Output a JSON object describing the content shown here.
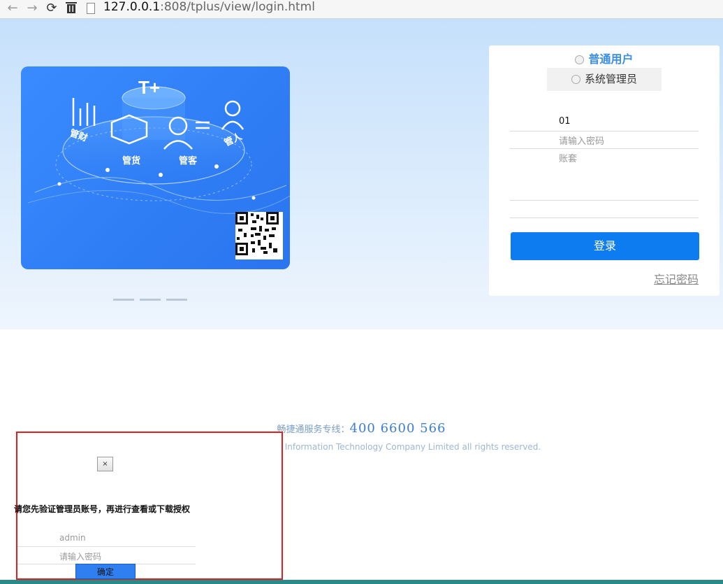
{
  "browser": {
    "url_host": "127.0.0.1",
    "url_path": ":808/tplus/view/login.html"
  },
  "hero": {
    "card": {
      "logo_text": "T+",
      "labels": [
        "管财",
        "管货",
        "管客",
        "管人"
      ]
    }
  },
  "login": {
    "role_normal": "普通用户",
    "role_admin": "系统管理员",
    "account_value": "01",
    "password_placeholder": "请输入密码",
    "book_placeholder": "账套",
    "submit_label": "登录",
    "forgot_label": "忘记密码"
  },
  "footer": {
    "hotline_label": "畅捷通服务专线：",
    "hotline_number": "400  6600  566",
    "copyright": "Copyright 2008-2018 Chanjet Information Technology Company Limited all rights reserved."
  },
  "modal": {
    "close_label": "×",
    "message": "请您先验证管理员账号，再进行查看或下载授权",
    "username_placeholder": "admin",
    "password_placeholder": "请输入密码",
    "confirm_label": "确定"
  },
  "colors": {
    "accent": "#0c7cf0",
    "role_active": "#3a8ee6",
    "modal_border": "#e02020"
  }
}
